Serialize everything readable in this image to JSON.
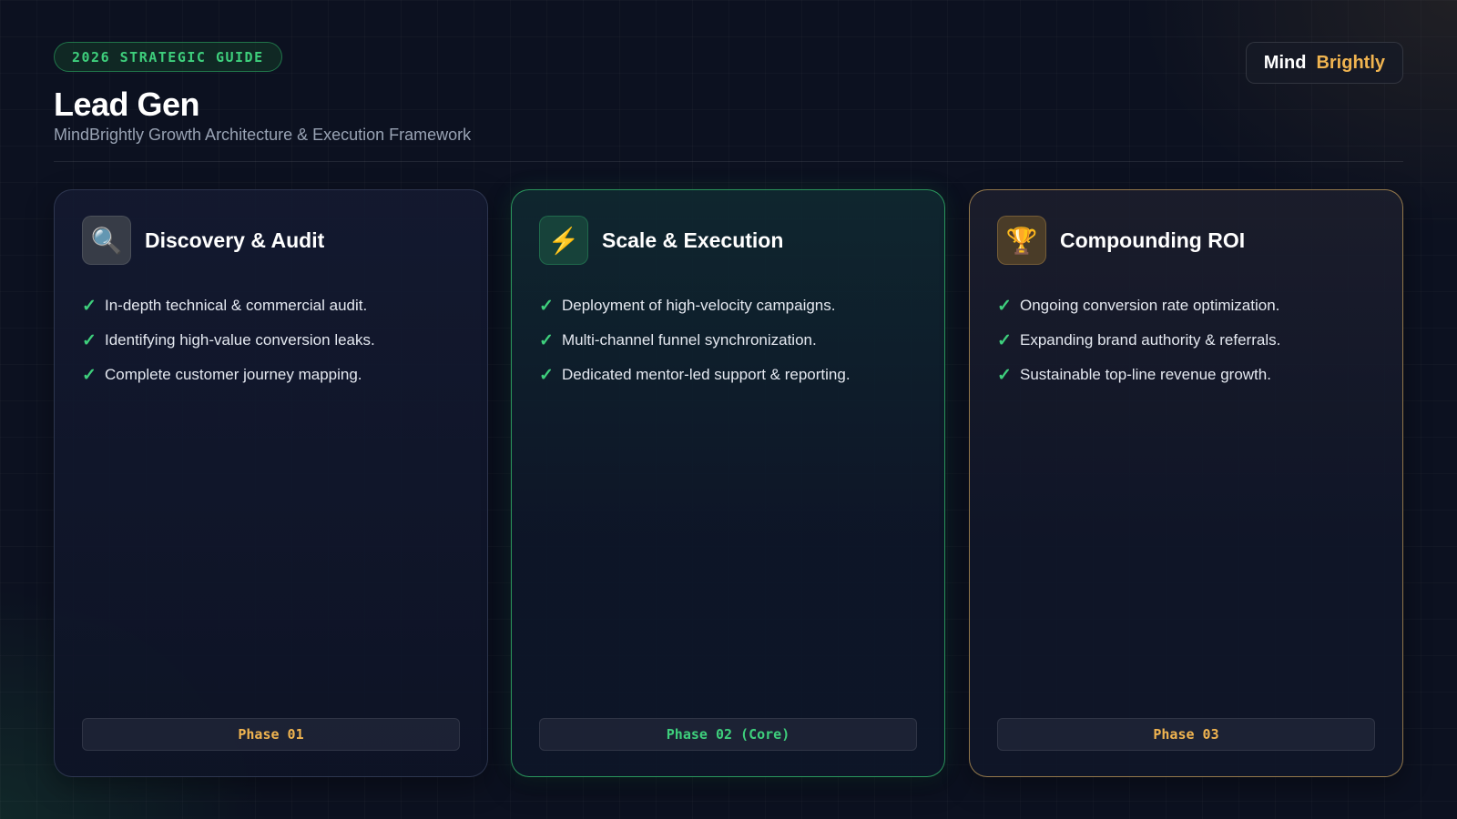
{
  "header": {
    "tag": "2026 STRATEGIC GUIDE",
    "title": "Lead Gen",
    "subtitle": "MindBrightly Growth Architecture & Execution Framework",
    "brand_part1": "Mind",
    "brand_part2": "Brightly"
  },
  "colors": {
    "background": "#0c1120",
    "accent_green": "#3ecf7c",
    "accent_gold": "#f0b450"
  },
  "cards": [
    {
      "icon": "magnifier-icon",
      "icon_glyph": "🔍",
      "title": "Discovery & Audit",
      "items": [
        "In-depth technical & commercial audit.",
        "Identifying high-value conversion leaks.",
        "Complete customer journey mapping."
      ],
      "phase": "Phase 01"
    },
    {
      "icon": "lightning-icon",
      "icon_glyph": "⚡",
      "title": "Scale & Execution",
      "items": [
        "Deployment of high-velocity campaigns.",
        "Multi-channel funnel synchronization.",
        "Dedicated mentor-led support & reporting."
      ],
      "phase": "Phase 02 (Core)"
    },
    {
      "icon": "trophy-icon",
      "icon_glyph": "🏆",
      "title": "Compounding ROI",
      "items": [
        "Ongoing conversion rate optimization.",
        "Expanding brand authority & referrals.",
        "Sustainable top-line revenue growth."
      ],
      "phase": "Phase 03"
    }
  ],
  "check_glyph": "✓"
}
